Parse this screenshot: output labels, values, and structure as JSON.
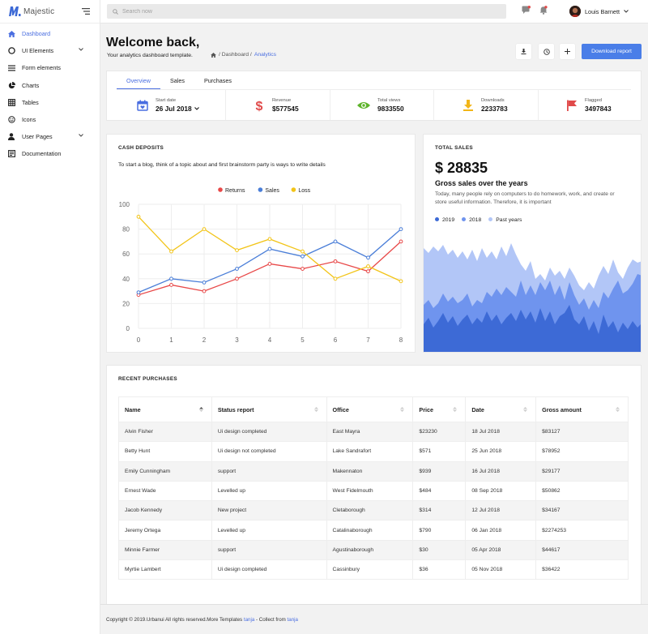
{
  "brand": {
    "name": "Majestic",
    "accent": "#4a6ee0"
  },
  "sidebar": {
    "items": [
      {
        "label": "Dashboard",
        "icon": "home-icon"
      },
      {
        "label": "UI Elements",
        "icon": "circle-icon"
      },
      {
        "label": "Form elements",
        "icon": "list-icon"
      },
      {
        "label": "Charts",
        "icon": "pie-chart-icon"
      },
      {
        "label": "Tables",
        "icon": "table-icon"
      },
      {
        "label": "Icons",
        "icon": "smiley-icon"
      },
      {
        "label": "User Pages",
        "icon": "user-icon"
      },
      {
        "label": "Documentation",
        "icon": "book-icon"
      }
    ]
  },
  "topbar": {
    "search_placeholder": "Search now",
    "user_name": "Louis Barnett"
  },
  "header": {
    "title": "Welcome back,",
    "subtitle": "Your analytics dashboard template.",
    "breadcrumb": [
      " / Dashboard / ",
      "Analytics"
    ],
    "download_label": "Download report"
  },
  "stats": {
    "tabs": [
      "Overview",
      "Sales",
      "Purchases"
    ],
    "items": [
      {
        "label": "Start date",
        "value": "26 Jul 2018",
        "icon": "calendar-icon",
        "color": "#4a6ee0"
      },
      {
        "label": "Revenue",
        "value": "$577545",
        "icon": "dollar-icon",
        "color": "#e04a4a"
      },
      {
        "label": "Total views",
        "value": "9833550",
        "icon": "eye-icon",
        "color": "#5db32a"
      },
      {
        "label": "Downloads",
        "value": "2233783",
        "icon": "download-icon",
        "color": "#f2b517"
      },
      {
        "label": "Flagged",
        "value": "3497843",
        "icon": "flag-icon",
        "color": "#e04a4a"
      }
    ]
  },
  "cash": {
    "title": "CASH DEPOSITS",
    "text": "To start a blog, think of a topic about and first brainstorm party is ways to write details"
  },
  "chart_data": {
    "type": "line",
    "x": [
      0,
      1,
      2,
      3,
      4,
      5,
      6,
      7,
      8
    ],
    "series": [
      {
        "name": "Returns",
        "color": "#e84848",
        "values": [
          27,
          35,
          30,
          40,
          52,
          48,
          54,
          46,
          70
        ]
      },
      {
        "name": "Sales",
        "color": "#4a7ed8",
        "values": [
          29,
          40,
          37,
          48,
          64,
          58,
          70,
          57,
          80
        ]
      },
      {
        "name": "Loss",
        "color": "#f2c418",
        "values": [
          90,
          62,
          80,
          63,
          72,
          62,
          40,
          50,
          38
        ]
      }
    ],
    "yticks": [
      0,
      20,
      40,
      60,
      80,
      100
    ],
    "ylim": [
      0,
      100
    ],
    "xlim": [
      0,
      8
    ],
    "grid": true,
    "legend": "top-center"
  },
  "total_sales": {
    "title": "TOTAL SALES",
    "amount": "$ 28835",
    "heading": "Gross sales over the years",
    "description": "Today, many people rely on computers to do homework, work, and create or store useful information. Therefore, it is important",
    "legend": [
      {
        "name": "2019",
        "color": "#3d6ad6"
      },
      {
        "name": "2018",
        "color": "#6f94ee"
      },
      {
        "name": "Past years",
        "color": "#b2c6f7"
      }
    ]
  },
  "purchases": {
    "title": "RECENT PURCHASES",
    "columns": [
      "Name",
      "Status report",
      "Office",
      "Price",
      "Date",
      "Gross amount"
    ],
    "rows": [
      [
        "Alvin Fisher",
        "Ui design completed",
        "East Mayra",
        "$23230",
        "18 Jul 2018",
        "$83127"
      ],
      [
        "Betty Hunt",
        "Ui design not completed",
        "Lake Sandrafort",
        "$571",
        "25 Jun 2018",
        "$78952"
      ],
      [
        "Emily Cunningham",
        "support",
        "Makennaton",
        "$939",
        "16 Jul 2018",
        "$29177"
      ],
      [
        "Ernest Wade",
        "Levelled up",
        "West Fidelmouth",
        "$484",
        "08 Sep 2018",
        "$50862"
      ],
      [
        "Jacob Kennedy",
        "New project",
        "Cletaborough",
        "$314",
        "12 Jul 2018",
        "$34167"
      ],
      [
        "Jeremy Ortega",
        "Levelled up",
        "Catalinaborough",
        "$790",
        "06 Jan 2018",
        "$2274253"
      ],
      [
        "Minnie Farmer",
        "support",
        "Agustinaborough",
        "$30",
        "05 Apr 2018",
        "$44617"
      ],
      [
        "Myrtie Lambert",
        "Ui design completed",
        "Cassinbury",
        "$36",
        "05 Nov 2018",
        "$36422"
      ]
    ]
  },
  "footer": {
    "text": "Copyright © 2019.Urbanui All rights reserved.More Templates ",
    "link1": "tanja",
    "middle": " - Collect from ",
    "link2": "tanja"
  }
}
